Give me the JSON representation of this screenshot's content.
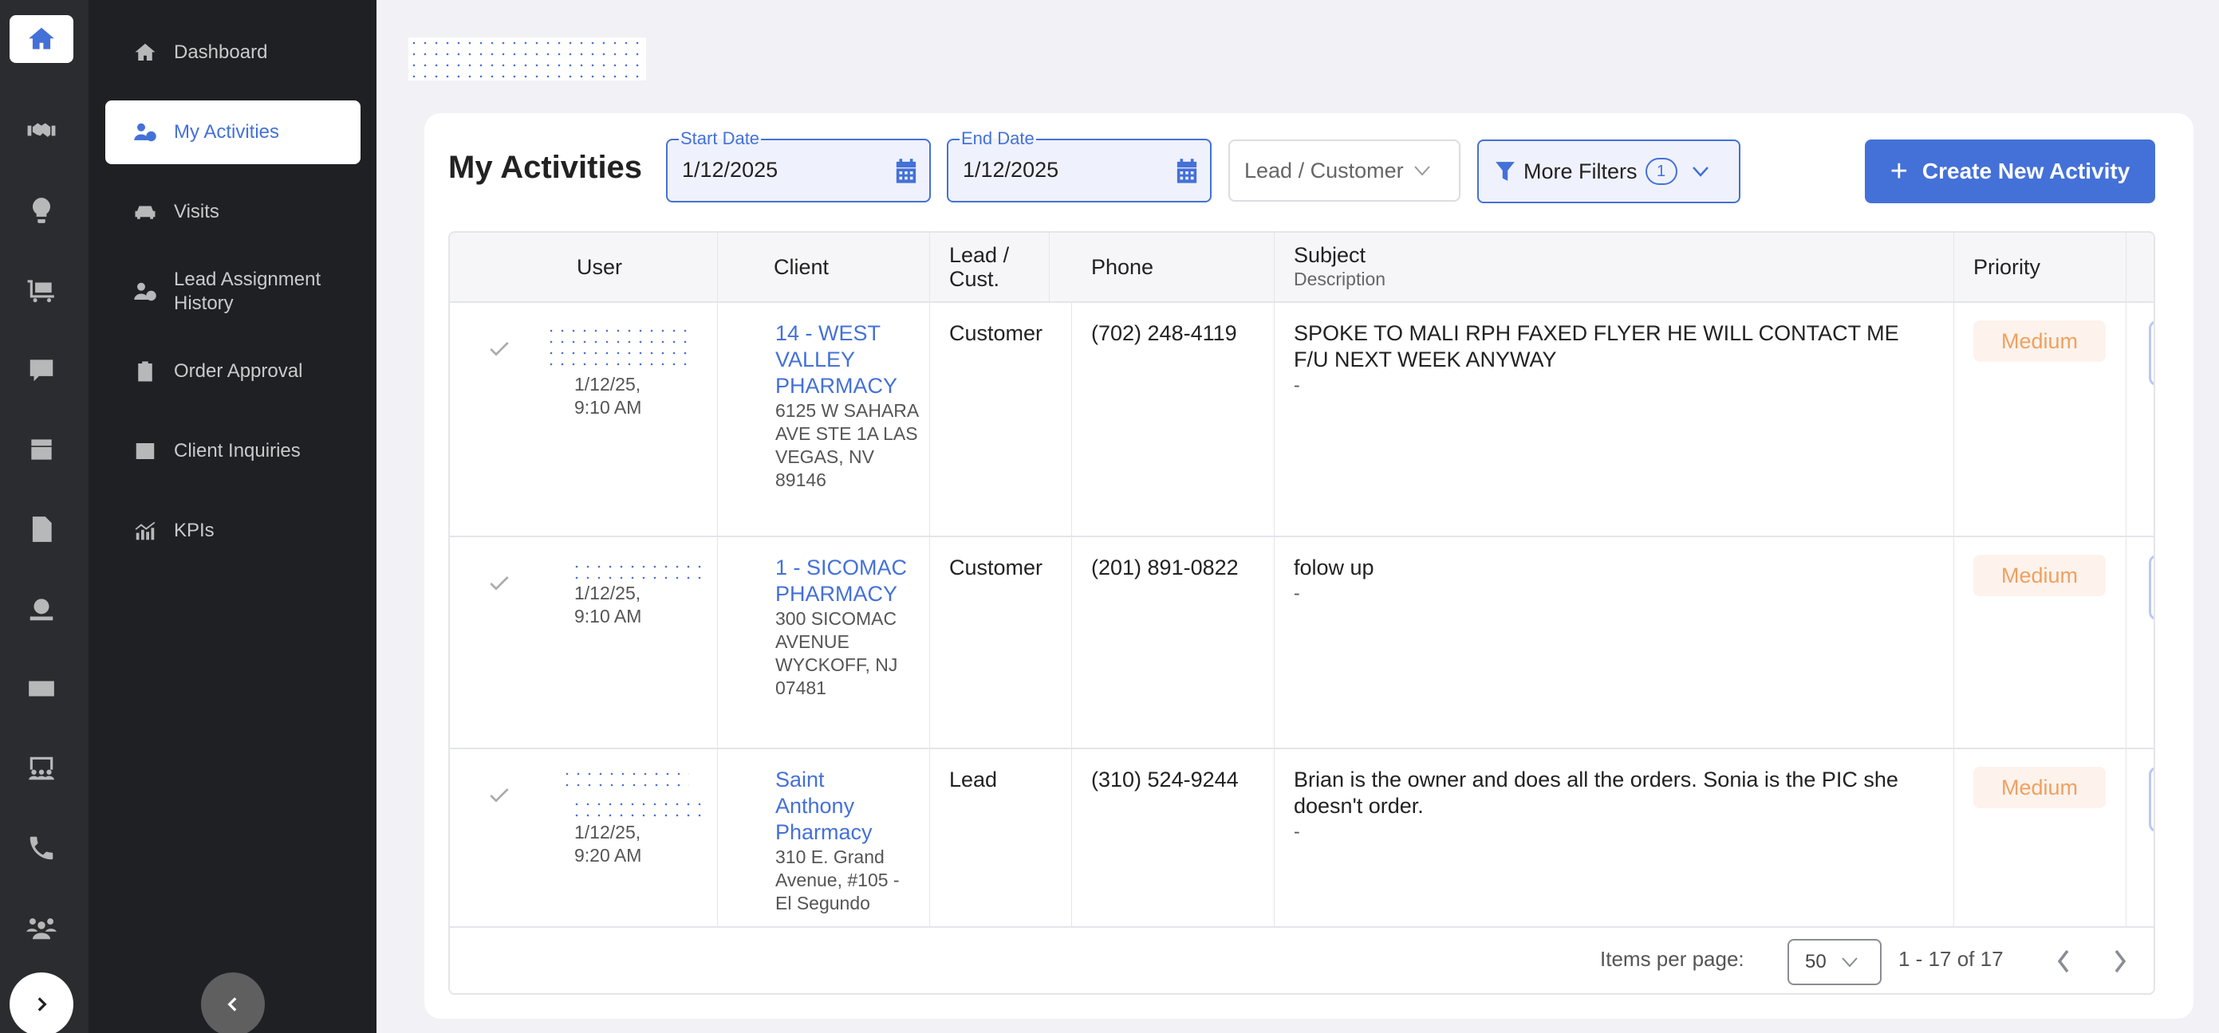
{
  "colors": {
    "accent": "#4471d8",
    "rail_bg": "#2b2c2f",
    "nav_bg": "#1f2023",
    "page_bg": "#f1f1f6",
    "priority_medium_text": "#f0a060",
    "priority_medium_bg": "#fdf3ec"
  },
  "rail": {
    "items": [
      {
        "icon": "home-icon",
        "active": true
      },
      {
        "icon": "handshake-icon"
      },
      {
        "icon": "lightbulb-dollar-icon"
      },
      {
        "icon": "dolly-cart-icon"
      },
      {
        "icon": "comment-dollar-icon"
      },
      {
        "icon": "box-check-icon"
      },
      {
        "icon": "file-invoice-dollar-icon"
      },
      {
        "icon": "hand-holding-dollar-icon"
      },
      {
        "icon": "money-check-icon"
      },
      {
        "icon": "chalkboard-users-icon"
      },
      {
        "icon": "phone-icon"
      },
      {
        "icon": "users-icon"
      }
    ],
    "expand_icon": "chevron-right-icon"
  },
  "nav": {
    "items": [
      {
        "label": "Dashboard",
        "icon": "home-icon"
      },
      {
        "label": "My Activities",
        "icon": "user-clock-icon",
        "active": true
      },
      {
        "label": "Visits",
        "icon": "car-icon"
      },
      {
        "label": "Lead Assignment History",
        "icon": "user-clock-icon"
      },
      {
        "label": "Order Approval",
        "icon": "clipboard-list-icon"
      },
      {
        "label": "Client Inquiries",
        "icon": "question-square-icon"
      },
      {
        "label": "KPIs",
        "icon": "chart-line-icon"
      }
    ],
    "collapse_icon": "chevron-left-icon"
  },
  "header": {
    "title": "My Activities",
    "start_date": {
      "label": "Start Date",
      "value": "1/12/2025"
    },
    "end_date": {
      "label": "End Date",
      "value": "1/12/2025"
    },
    "lead_customer_select": {
      "placeholder": "Lead / Customer"
    },
    "more_filters": {
      "label": "More Filters",
      "count": "1"
    },
    "create_button": {
      "label": "Create New Activity",
      "icon": "+"
    }
  },
  "table": {
    "columns": [
      {
        "label": "User"
      },
      {
        "label": "Client"
      },
      {
        "label": "Lead / Cust."
      },
      {
        "label": "Phone"
      },
      {
        "label": "Subject",
        "sub": "Description"
      },
      {
        "label": "Priority"
      },
      {
        "label": ""
      }
    ],
    "rows": [
      {
        "datetime": "1/12/25, 9:10 AM",
        "client_name": "14 - WEST VALLEY PHARMACY",
        "client_address": "6125 W SAHARA AVE STE 1A LAS VEGAS, NV 89146",
        "type": "Customer",
        "phone": "(702) 248-4119",
        "subject": "SPOKE TO MALI RPH FAXED FLYER HE WILL CONTACT ME F/U NEXT WEEK ANYWAY",
        "description": "-",
        "priority": "Medium"
      },
      {
        "datetime": "1/12/25, 9:10 AM",
        "client_name": "1 - SICOMAC PHARMACY",
        "client_address": "300 SICOMAC AVENUE WYCKOFF, NJ 07481",
        "type": "Customer",
        "phone": "(201) 891-0822",
        "subject": "folow up",
        "description": "-",
        "priority": "Medium"
      },
      {
        "datetime": "1/12/25, 9:20 AM",
        "client_name": "Saint Anthony Pharmacy",
        "client_address": "310 E. Grand Avenue, #105 - El Segundo",
        "type": "Lead",
        "phone": "(310) 524-9244",
        "subject": "Brian is the owner and does all the orders. Sonia is the PIC she doesn't order.",
        "description": "-",
        "priority": "Medium"
      }
    ]
  },
  "pagination": {
    "items_per_page_label": "Items per page:",
    "items_per_page": "50",
    "range": "1 - 17 of 17"
  }
}
